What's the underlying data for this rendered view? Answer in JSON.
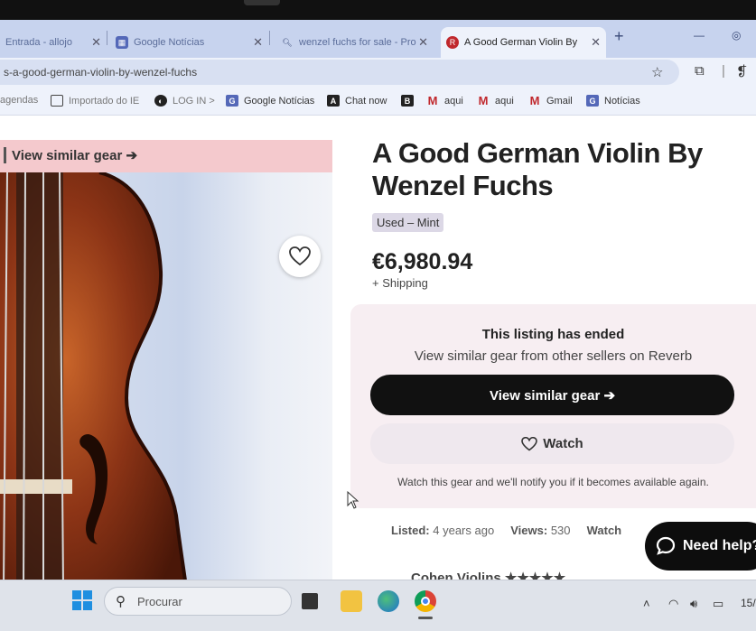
{
  "tabs": [
    {
      "label": "Entrada - allojo",
      "active": false
    },
    {
      "label": "Google Notícias",
      "active": false
    },
    {
      "label": "wenzel fuchs for sale - Pro",
      "active": false
    },
    {
      "label": "A Good German Violin By",
      "active": true
    }
  ],
  "address": {
    "url": "s-a-good-german-violin-by-wenzel-fuchs"
  },
  "bookmarks": [
    "agendas",
    "Importado do IE",
    "LOG IN >",
    "Google Notícias",
    "Chat now",
    "aqui",
    "aqui",
    "Gmail",
    "Notícias"
  ],
  "listing": {
    "similar_bar": "View similar gear ➔",
    "title": "A Good German Violin By Wenzel Fuchs",
    "condition": "Used – Mint",
    "price": "€6,980.94",
    "shipping": "+ Shipping"
  },
  "ended": {
    "heading": "This listing has ended",
    "subheading": "View similar gear from other sellers on Reverb",
    "primary_button": "View similar gear ➔",
    "watch_button": "Watch",
    "note": "Watch this gear and we'll notify you if it becomes available again."
  },
  "stats": {
    "listed_label": "Listed:",
    "listed_value": "4 years ago",
    "views_label": "Views:",
    "views_value": "530",
    "watchers_label": "Watch"
  },
  "help": {
    "label": "Need help?"
  },
  "shop": {
    "name": "Cohen Violins ★★★★★"
  },
  "taskbar": {
    "search_placeholder": "Procurar",
    "clock": "15/"
  },
  "colors": {
    "accent_pink": "#f4c9cd",
    "primary_button": "#111111",
    "tab_bar": "#c7d3ee"
  }
}
